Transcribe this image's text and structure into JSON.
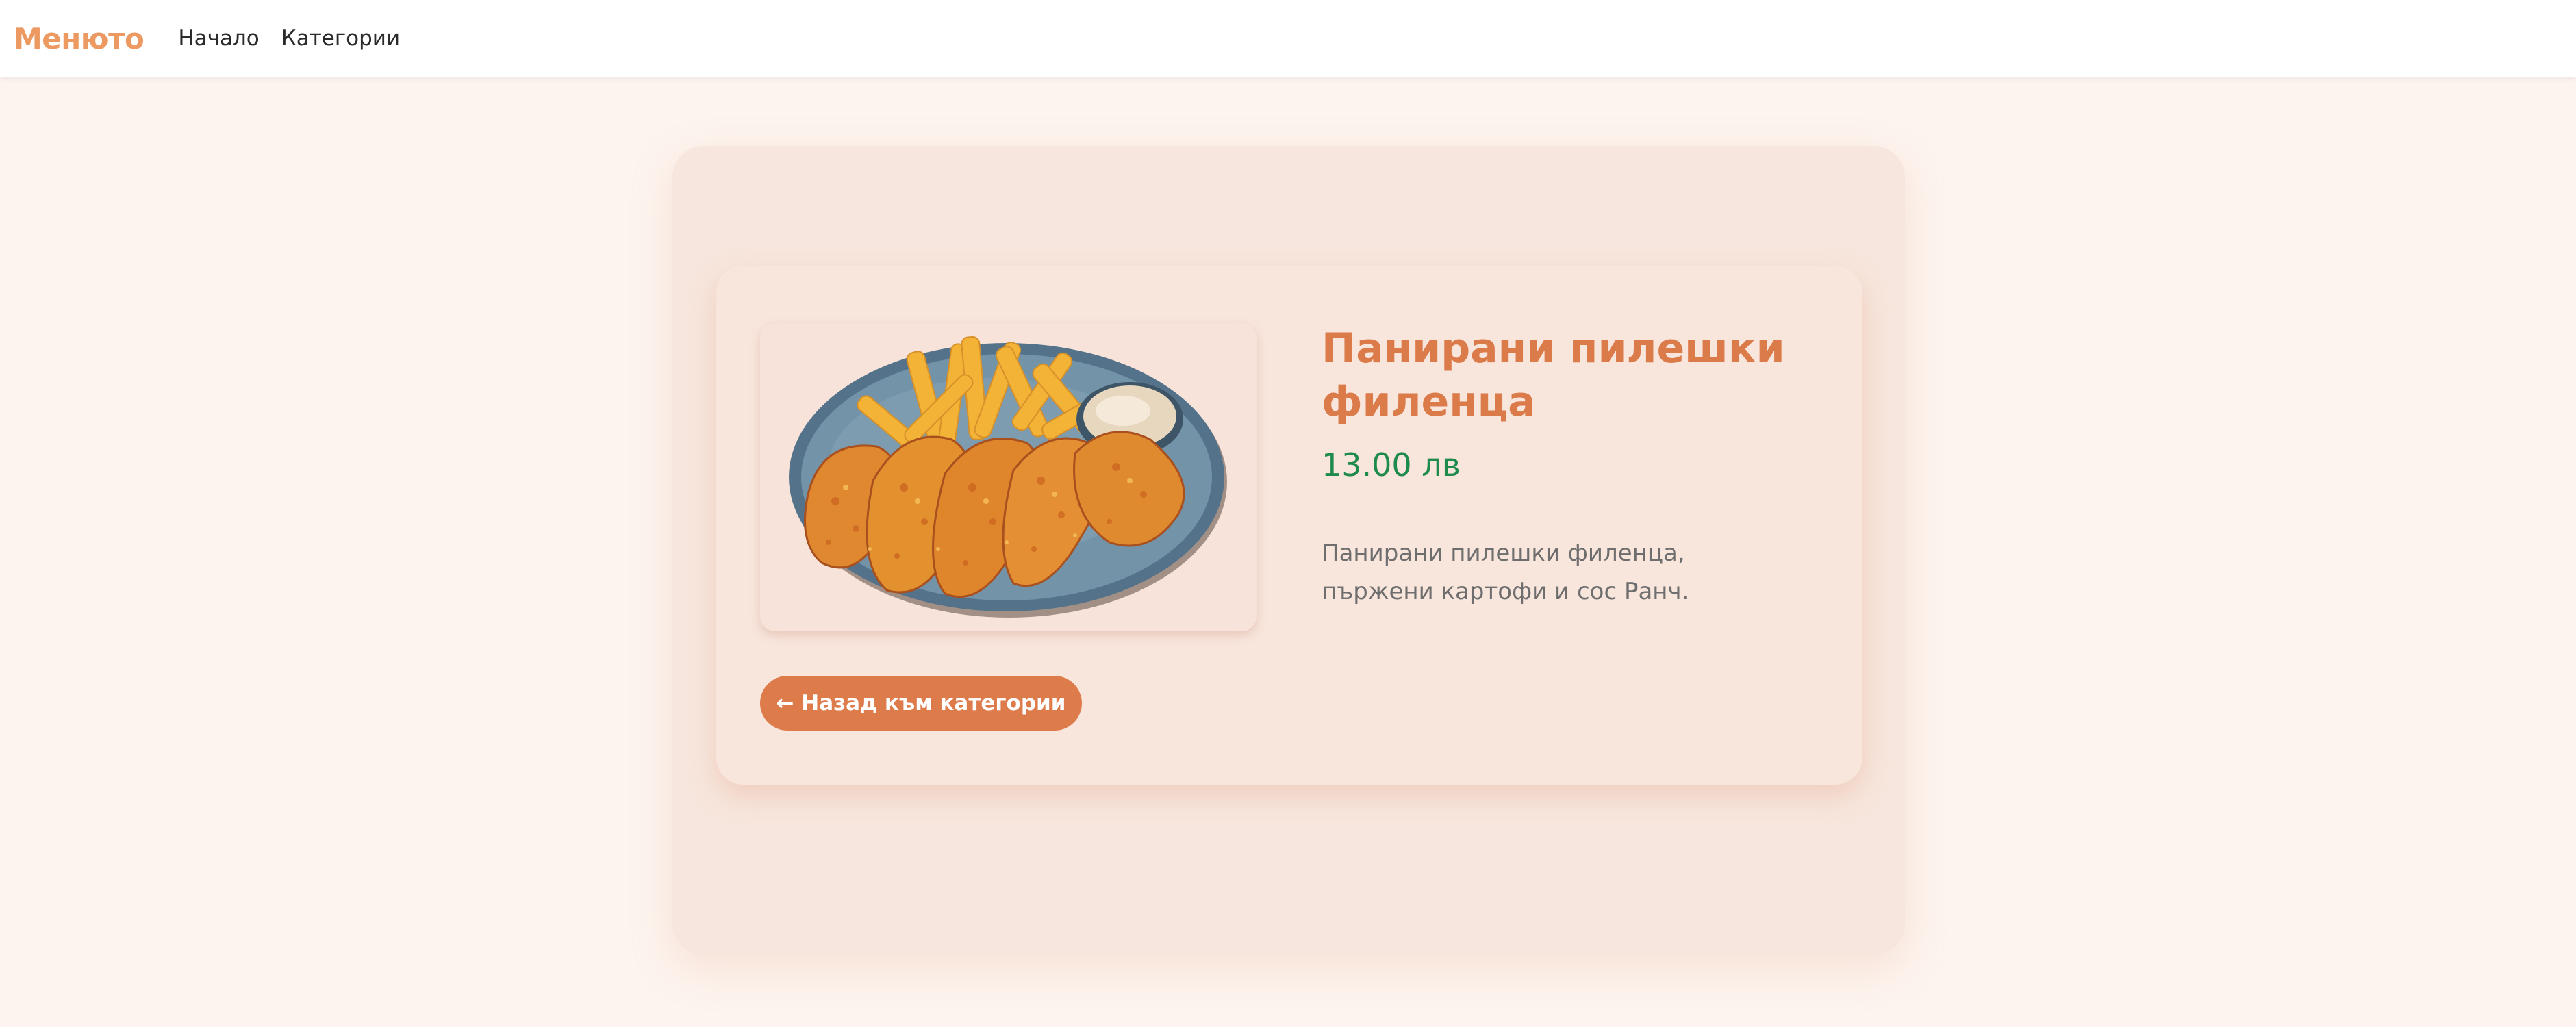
{
  "navbar": {
    "brand": "Менюто",
    "links": [
      "Начало",
      "Категории"
    ]
  },
  "product": {
    "title": "Панирани пилешки филенца",
    "price": "13.00 лв",
    "description": "Панирани пилешки филенца, пържени картофи и сос Ранч.",
    "image_icon": "food-photo-chicken-tenders-fries-ranch"
  },
  "actions": {
    "back_label": "← Назад към категории"
  },
  "colors": {
    "brand": "#ec9a62",
    "title": "#db7b4a",
    "price": "#1e8a4c",
    "button": "#de7b4b",
    "page_bg": "#fdf4ef",
    "panel_bg": "#f7e6dd"
  }
}
